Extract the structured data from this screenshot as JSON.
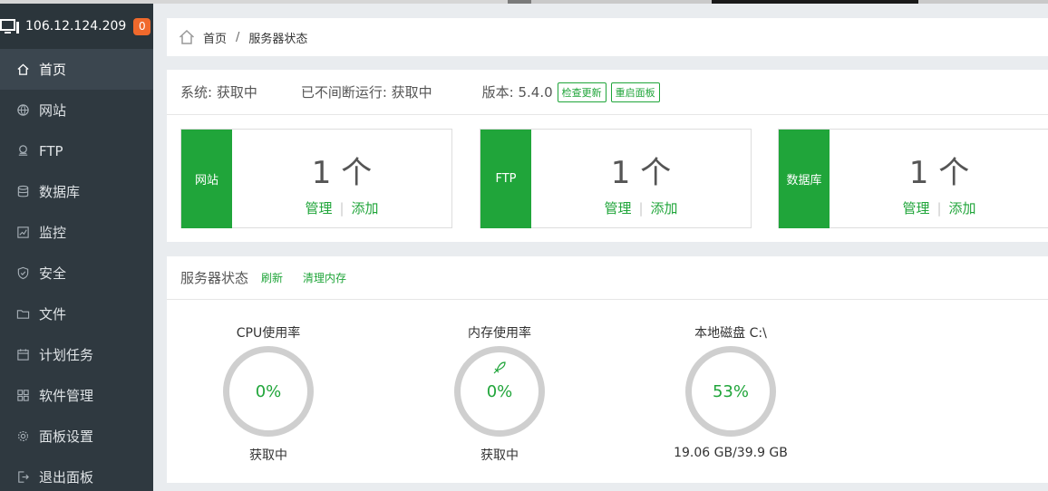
{
  "server": {
    "ip": "106.12.124.209",
    "badge": "0"
  },
  "nav": [
    {
      "label": "首页",
      "icon": "home-icon",
      "active": true
    },
    {
      "label": "网站",
      "icon": "globe-icon"
    },
    {
      "label": "FTP",
      "icon": "ftp-icon"
    },
    {
      "label": "数据库",
      "icon": "database-icon"
    },
    {
      "label": "监控",
      "icon": "monitor-chart-icon"
    },
    {
      "label": "安全",
      "icon": "shield-icon"
    },
    {
      "label": "文件",
      "icon": "folder-icon"
    },
    {
      "label": "计划任务",
      "icon": "calendar-icon"
    },
    {
      "label": "软件管理",
      "icon": "grid-apps-icon"
    },
    {
      "label": "面板设置",
      "icon": "gear-icon"
    },
    {
      "label": "退出面板",
      "icon": "logout-icon"
    }
  ],
  "breadcrumb": {
    "home": "首页",
    "separator": "/",
    "current": "服务器状态"
  },
  "system": {
    "system_text": "系统: 获取中",
    "uptime_text": "已不间断运行: 获取中",
    "version_text": "版本: 5.4.0",
    "check_update": "检查更新",
    "restart_panel": "重启面板"
  },
  "stats": [
    {
      "label": "网站",
      "count": "1 个",
      "manage": "管理",
      "add": "添加"
    },
    {
      "label": "FTP",
      "count": "1 个",
      "manage": "管理",
      "add": "添加"
    },
    {
      "label": "数据库",
      "count": "1 个",
      "manage": "管理",
      "add": "添加"
    }
  ],
  "server_status": {
    "title": "服务器状态",
    "refresh": "刷新",
    "clear_memory": "清理内存",
    "gauges": [
      {
        "title": "CPU使用率",
        "percent": "0%",
        "sub": "获取中"
      },
      {
        "title": "内存使用率",
        "percent": "0%",
        "sub": "获取中"
      },
      {
        "title": "本地磁盘 C:\\",
        "percent": "53%",
        "sub": "19.06 GB/39.9 GB"
      }
    ]
  },
  "colors": {
    "accent": "#20a53a",
    "sidebar": "#2f3940",
    "badge": "#f0692c"
  }
}
